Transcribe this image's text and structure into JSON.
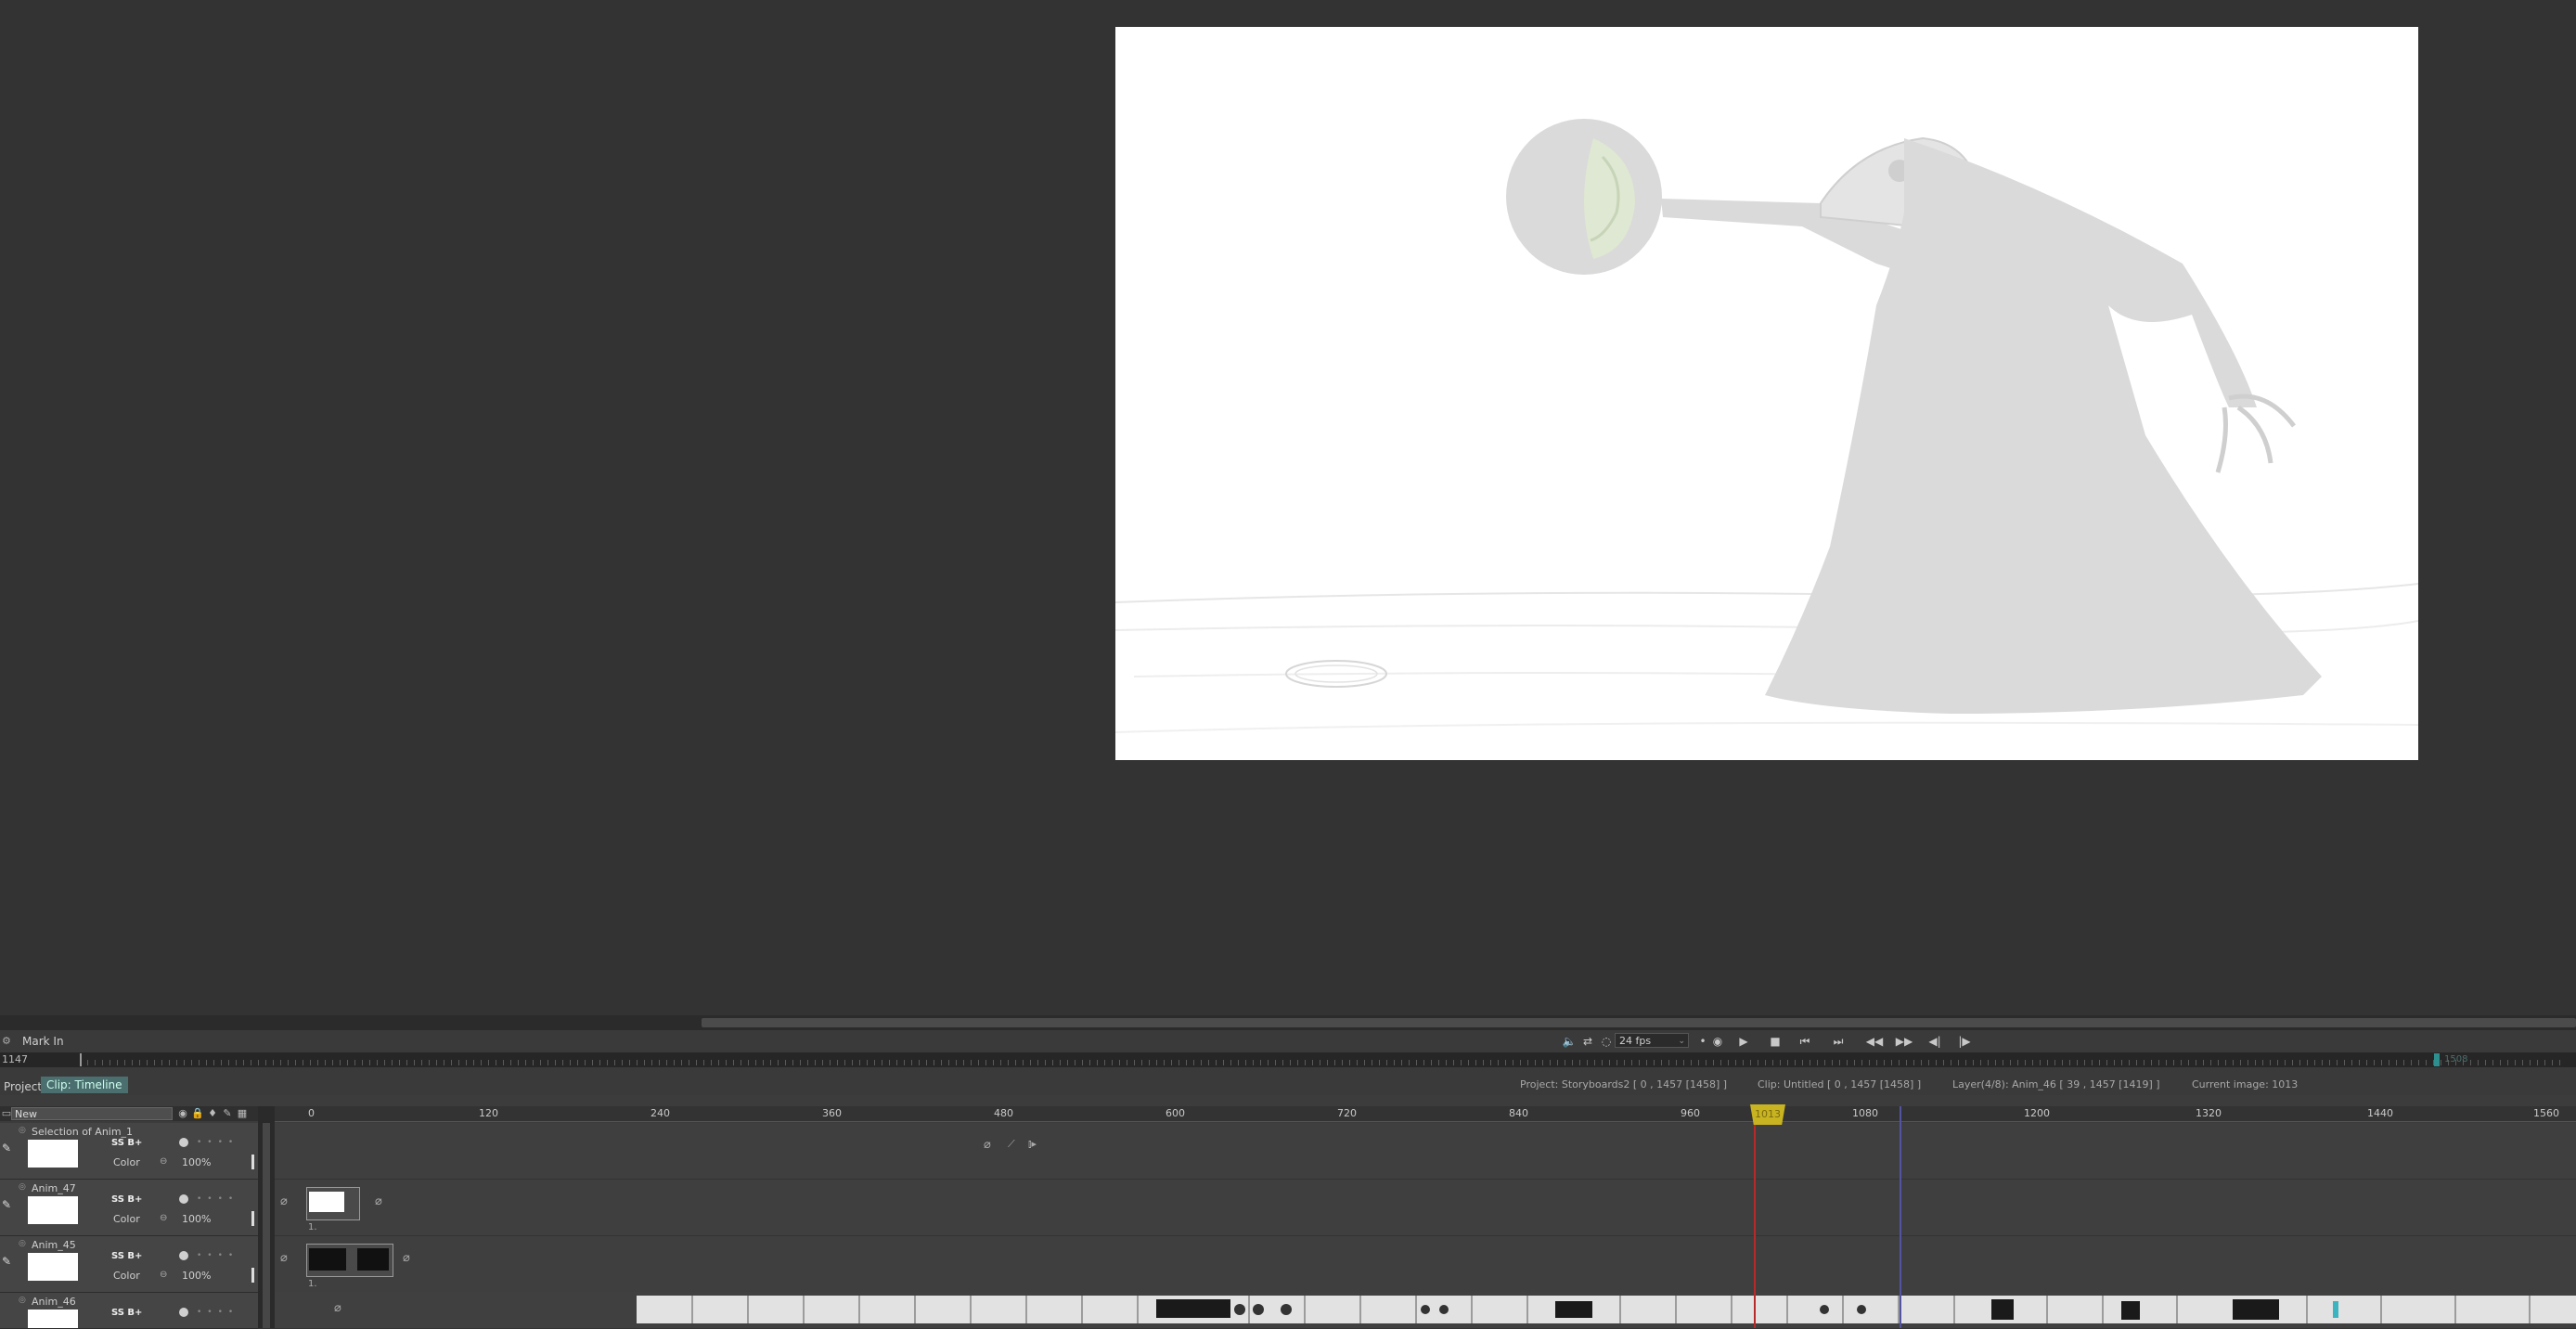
{
  "transport": {
    "mark_in_label": "Mark In",
    "fps": "24 fps",
    "buttons": [
      {
        "name": "audio-icon",
        "glyph": "🔈"
      },
      {
        "name": "loop-icon",
        "glyph": "⇄"
      },
      {
        "name": "onion-icon",
        "glyph": "◌"
      },
      {
        "name": "frame-dot-icon",
        "glyph": "•"
      },
      {
        "name": "record-icon",
        "glyph": "⏺"
      },
      {
        "name": "play-icon",
        "glyph": "▶"
      },
      {
        "name": "stop-icon",
        "glyph": "■"
      },
      {
        "name": "first-frame-icon",
        "glyph": "⏮"
      },
      {
        "name": "last-frame-icon",
        "glyph": "⏭"
      },
      {
        "name": "prev-key-icon",
        "glyph": "◀◀"
      },
      {
        "name": "next-key-icon",
        "glyph": "▶▶"
      },
      {
        "name": "prev-frame-icon",
        "glyph": "◀|"
      },
      {
        "name": "next-frame-icon",
        "glyph": "|▶"
      }
    ]
  },
  "scrub": {
    "current_frame": "1147",
    "end_label": "1508"
  },
  "tabs": {
    "project": "Project",
    "clip": "Clip: Timeline"
  },
  "info": {
    "project": "Project: Storyboards2 [ 0 , 1457  [1458] ]",
    "clip": "Clip: Untitled [ 0 , 1457  [1458] ]",
    "layer": "Layer(4/8): Anim_46 [ 39 , 1457  [1419] ]",
    "current_image": "Current image: 1013"
  },
  "timeline": {
    "new_field": "New",
    "ruler": [
      "0",
      "120",
      "240",
      "360",
      "480",
      "600",
      "720",
      "840",
      "960",
      "1080",
      "1200",
      "1320",
      "1440",
      "1560"
    ],
    "playhead_label": "1013",
    "layers": [
      {
        "name": "Selection of Anim_1",
        "ss": "SS B+",
        "color_label": "Color",
        "opacity": "100%"
      },
      {
        "name": "Anim_47",
        "ss": "SS B+",
        "color_label": "Color",
        "opacity": "100%"
      },
      {
        "name": "Anim_45",
        "ss": "SS B+",
        "color_label": "Color",
        "opacity": "100%"
      },
      {
        "name": "Anim_46",
        "ss": "SS B+",
        "color_label": "",
        "opacity": ""
      }
    ],
    "track_numbers": [
      "1.",
      "1."
    ]
  },
  "colors": {
    "accent_tab": "#4b6e6e",
    "playhead": "#c8b420",
    "playhead_line": "#b72a2a",
    "marker_blue": "#5254a0",
    "character_grey": "#dadada",
    "orb_green": "#dfe8d2"
  }
}
